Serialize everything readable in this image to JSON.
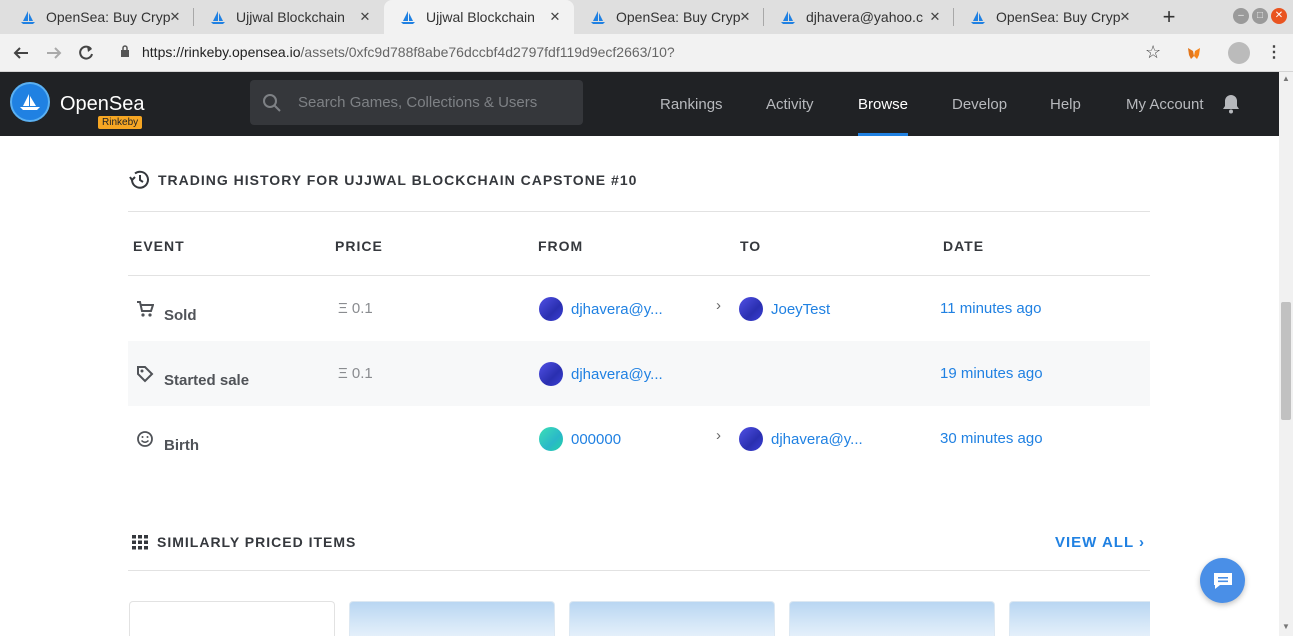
{
  "browser": {
    "tabs": [
      {
        "title": "OpenSea: Buy Cryp",
        "active": false
      },
      {
        "title": "Ujjwal Blockchain",
        "active": false
      },
      {
        "title": "Ujjwal Blockchain",
        "active": true
      },
      {
        "title": "OpenSea: Buy Cryp",
        "active": false
      },
      {
        "title": "djhavera@yahoo.c",
        "active": false
      },
      {
        "title": "OpenSea: Buy Cryp",
        "active": false
      }
    ],
    "url_host": "https://rinkeby.opensea.io",
    "url_path": "/assets/0xfc9d788f8abe76dccbf4d2797fdf119d9ecf2663/10?"
  },
  "header": {
    "brand": "OpenSea",
    "badge": "Rinkeby",
    "search_placeholder": "Search Games, Collections & Users",
    "nav": [
      "Rankings",
      "Activity",
      "Browse",
      "Develop",
      "Help",
      "My Account"
    ],
    "active_nav": "Browse",
    "accent": "#2081e2"
  },
  "trading_history": {
    "title": "TRADING HISTORY FOR UJJWAL BLOCKCHAIN CAPSTONE #10",
    "columns": [
      "EVENT",
      "PRICE",
      "FROM",
      "TO",
      "DATE"
    ],
    "rows": [
      {
        "event": "Sold",
        "icon": "cart-icon",
        "price": "Ξ 0.1",
        "from": "djhavera@y...",
        "from_avatar": "blue",
        "to": "JoeyTest",
        "to_avatar": "blue",
        "date": "11 minutes ago"
      },
      {
        "event": "Started sale",
        "icon": "tag-icon",
        "price": "Ξ 0.1",
        "from": "djhavera@y...",
        "from_avatar": "blue",
        "to": "",
        "to_avatar": "",
        "date": "19 minutes ago"
      },
      {
        "event": "Birth",
        "icon": "smiley-icon",
        "price": "",
        "from": "000000",
        "from_avatar": "teal",
        "to": "djhavera@y...",
        "to_avatar": "blue",
        "date": "30 minutes ago"
      }
    ]
  },
  "similar": {
    "title": "SIMILARLY PRICED ITEMS",
    "view_all": "VIEW ALL"
  }
}
